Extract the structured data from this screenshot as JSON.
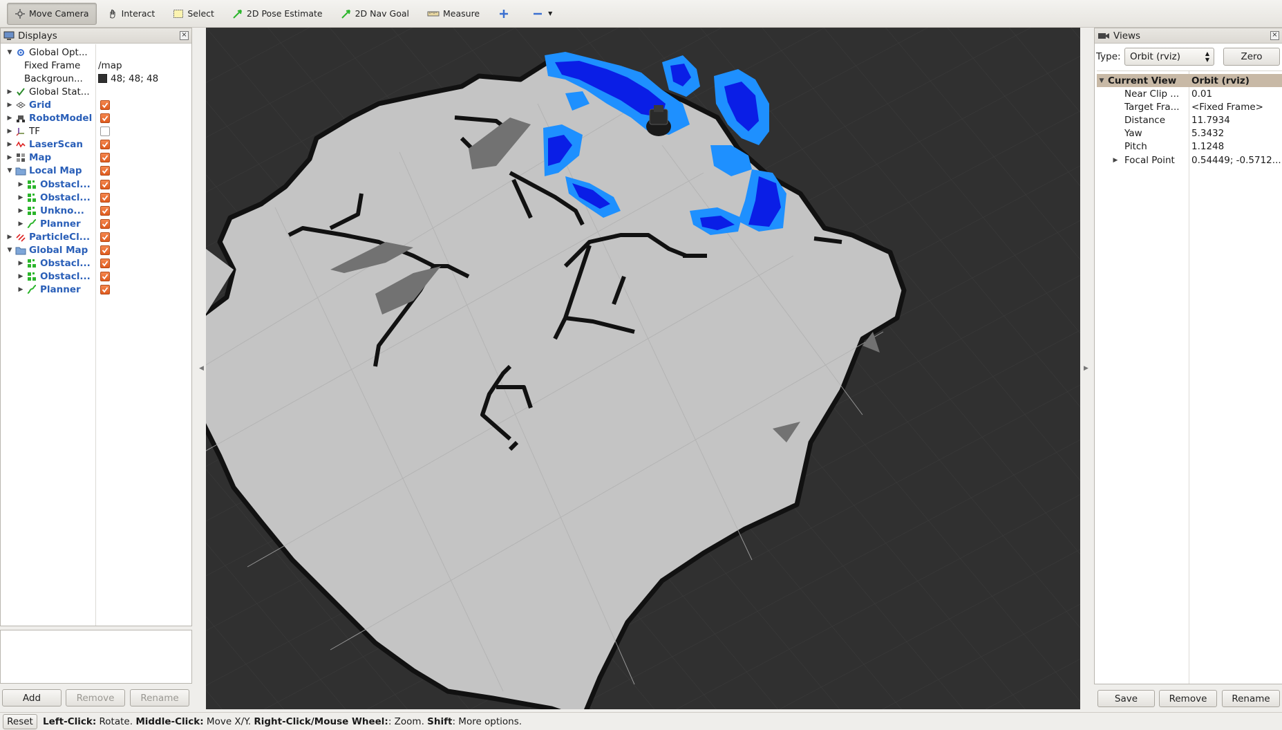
{
  "toolbar": {
    "tools": [
      {
        "label": "Move Camera",
        "icon": "move-camera-icon",
        "active": true
      },
      {
        "label": "Interact",
        "icon": "hand-icon"
      },
      {
        "label": "Select",
        "icon": "select-box-icon"
      },
      {
        "label": "2D Pose Estimate",
        "icon": "green-arrow-icon"
      },
      {
        "label": "2D Nav Goal",
        "icon": "green-arrow-icon"
      },
      {
        "label": "Measure",
        "icon": "ruler-icon"
      }
    ],
    "add_icon": "plus-icon",
    "remove_icon": "minus-icon"
  },
  "displays": {
    "title": "Displays",
    "rows": [
      {
        "label": "Global Opt...",
        "value": "",
        "arrow": "▼",
        "icon": "gear-icon",
        "indent": 0
      },
      {
        "label": "Fixed Frame",
        "value": "/map",
        "indent": 2
      },
      {
        "label": "Backgroun...",
        "value": "48; 48; 48",
        "indent": 2,
        "swatch": "#303030"
      },
      {
        "label": "Global Stat...",
        "value": "",
        "arrow": "▶",
        "icon": "check-icon",
        "indent": 0
      },
      {
        "label": "Grid",
        "blue": true,
        "arrow": "▶",
        "icon": "grid-icon",
        "indent": 0,
        "check": true
      },
      {
        "label": "RobotModel",
        "blue": true,
        "arrow": "▶",
        "icon": "robot-icon",
        "indent": 0,
        "check": true
      },
      {
        "label": "TF",
        "arrow": "▶",
        "icon": "tf-icon",
        "indent": 0,
        "check": false
      },
      {
        "label": "LaserScan",
        "blue": true,
        "arrow": "▶",
        "icon": "laser-icon",
        "indent": 0,
        "check": true
      },
      {
        "label": "Map",
        "blue": true,
        "arrow": "▶",
        "icon": "map-icon",
        "indent": 0,
        "check": true
      },
      {
        "label": "Local Map",
        "blue": true,
        "arrow": "▼",
        "icon": "folder-icon",
        "indent": 0,
        "check": true
      },
      {
        "label": "Obstacl...",
        "blue": true,
        "arrow": "▶",
        "icon": "grid-cells-icon",
        "indent": 1,
        "check": true
      },
      {
        "label": "Obstacl...",
        "blue": true,
        "arrow": "▶",
        "icon": "grid-cells-icon",
        "indent": 1,
        "check": true
      },
      {
        "label": "Unkno...",
        "blue": true,
        "arrow": "▶",
        "icon": "grid-cells-icon",
        "indent": 1,
        "check": true
      },
      {
        "label": "Planner",
        "blue": true,
        "arrow": "▶",
        "icon": "path-icon",
        "indent": 1,
        "check": true
      },
      {
        "label": "ParticleCl...",
        "blue": true,
        "arrow": "▶",
        "icon": "particles-icon",
        "indent": 0,
        "check": true
      },
      {
        "label": "Global Map",
        "blue": true,
        "arrow": "▼",
        "icon": "folder-icon",
        "indent": 0,
        "check": true
      },
      {
        "label": "Obstacl...",
        "blue": true,
        "arrow": "▶",
        "icon": "grid-cells-icon",
        "indent": 1,
        "check": true
      },
      {
        "label": "Obstacl...",
        "blue": true,
        "arrow": "▶",
        "icon": "grid-cells-icon",
        "indent": 1,
        "check": true
      },
      {
        "label": "Planner",
        "blue": true,
        "arrow": "▶",
        "icon": "path-icon",
        "indent": 1,
        "check": true
      }
    ],
    "buttons": {
      "add": "Add",
      "remove": "Remove",
      "rename": "Rename"
    }
  },
  "views": {
    "title": "Views",
    "type_label": "Type:",
    "type_value": "Orbit (rviz)",
    "zero_label": "Zero",
    "header": {
      "name": "Current View",
      "value": "Orbit (rviz)"
    },
    "props": [
      {
        "name": "Near Clip ...",
        "value": "0.01"
      },
      {
        "name": "Target Fra...",
        "value": "<Fixed Frame>"
      },
      {
        "name": "Distance",
        "value": "11.7934"
      },
      {
        "name": "Yaw",
        "value": "5.3432"
      },
      {
        "name": "Pitch",
        "value": "1.1248"
      },
      {
        "name": "Focal Point",
        "value": "0.54449; -0.5712...",
        "arrow": "▶"
      }
    ],
    "buttons": {
      "save": "Save",
      "remove": "Remove",
      "rename": "Rename"
    }
  },
  "status": {
    "reset_label": "Reset",
    "segments": [
      {
        "bold": "Left-Click:",
        "text": " Rotate. "
      },
      {
        "bold": "Middle-Click:",
        "text": " Move X/Y. "
      },
      {
        "bold": "Right-Click/Mouse Wheel:",
        "text": ": Zoom. "
      },
      {
        "bold": "Shift",
        "text": ": More options."
      }
    ]
  },
  "viewport": {
    "background": "#303030",
    "map_free_color": "#c4c4c4",
    "map_wall_color": "#111111",
    "map_unknown_color": "#727272",
    "local_obstacle_color": "#1e90ff",
    "inflated_color": "#0a1ee6"
  }
}
